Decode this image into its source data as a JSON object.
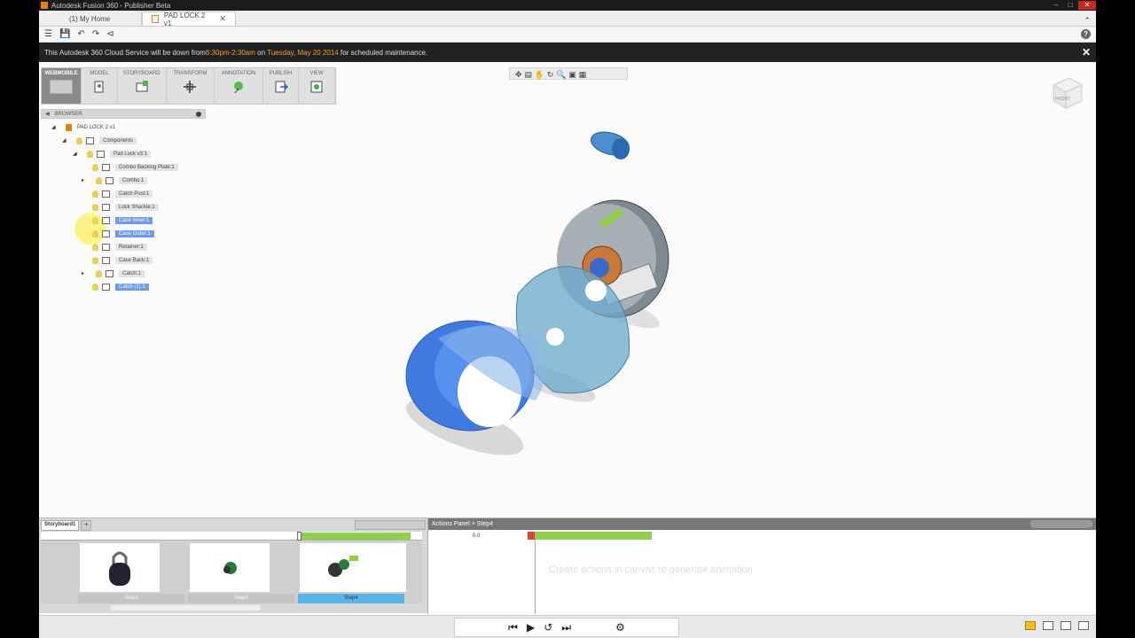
{
  "window": {
    "title": "Autodesk Fusion 360 - Publisher Beta"
  },
  "tabs": [
    {
      "label": "(1) My Home"
    },
    {
      "label": "PAD LOCK 2 v1"
    }
  ],
  "banner": {
    "prefix": "This Autodesk 360 Cloud Service will be down from ",
    "time": "8:30pm-2:30am",
    "mid": " on ",
    "date": "Tuesday, May 20 2014",
    "suffix": " for scheduled maintenance."
  },
  "toolbar": {
    "groups": [
      {
        "label": "WEBMOBILE"
      },
      {
        "label": "MODEL"
      },
      {
        "label": "STORYBOARD"
      },
      {
        "label": "TRANSFORM"
      },
      {
        "label": "ANNOTATION"
      },
      {
        "label": "PUBLISH"
      },
      {
        "label": "VIEW"
      }
    ]
  },
  "browser": {
    "header": "BROWSER",
    "nodes": [
      {
        "label": "PAD LOCK 2 v1"
      },
      {
        "label": "Components"
      },
      {
        "label": "Pad Lock v3:1"
      },
      {
        "label": "Combo Backing Plate:1"
      },
      {
        "label": "Combo:1"
      },
      {
        "label": "Catch Post:1"
      },
      {
        "label": "Lock Shackle:1"
      },
      {
        "label": "Case Inner:1"
      },
      {
        "label": "Case Outer:1"
      },
      {
        "label": "Retainer:1"
      },
      {
        "label": "Case Back:1"
      },
      {
        "label": "Catch:1"
      },
      {
        "label": "Catch (1):1"
      }
    ]
  },
  "viewcube": {
    "face": "FRONT"
  },
  "storyboard": {
    "tab": "Storyboard1",
    "add": "+",
    "steps": [
      {
        "label": "Step2"
      },
      {
        "label": "Step3"
      },
      {
        "label": "Step4"
      }
    ]
  },
  "actions_panel": {
    "title": "Actions Panel > Step4",
    "time": "0.0",
    "hint": "Create actions in canvas to generate animation"
  },
  "colors": {
    "accent": "#59b4e8",
    "selection": "#6e9ae8",
    "timeline_green": "#8fd04a",
    "banner_highlight": "#f0a030"
  }
}
